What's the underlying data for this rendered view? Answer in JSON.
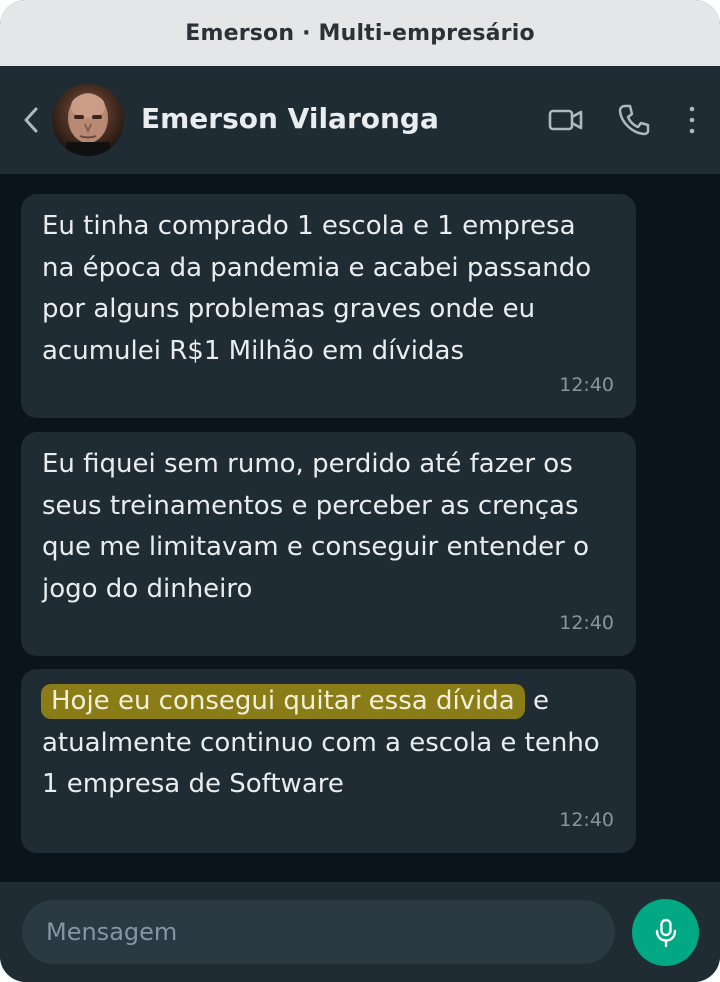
{
  "window": {
    "title": "Emerson · Multi-empresário"
  },
  "header": {
    "back_icon": "chevron-left-icon",
    "contact_name": "Emerson Vilaronga",
    "actions": [
      "video-call-icon",
      "phone-icon",
      "more-vertical-icon"
    ]
  },
  "messages": [
    {
      "text": "Eu tinha comprado 1 escola e 1 empresa na época da pandemia e acabei passando por alguns problemas graves onde eu acumulei R$1 Milhão em dívidas",
      "time": "12:40"
    },
    {
      "text": "Eu fiquei sem rumo, perdido até fazer os seus treinamentos e perceber as crenças que me limitavam e conseguir entender o jogo do dinheiro",
      "time": "12:40"
    },
    {
      "highlight": "Hoje eu consegui quitar essa dívida",
      "text": " e atualmente continuo com a escola e tenho 1 empresa de Software",
      "time": "12:40"
    }
  ],
  "composer": {
    "placeholder": "Mensagem",
    "send_icon": "microphone-icon"
  },
  "colors": {
    "accent": "#00a884",
    "highlight": "#8a7d17",
    "bubble": "#202c33",
    "background": "#0b141a"
  }
}
